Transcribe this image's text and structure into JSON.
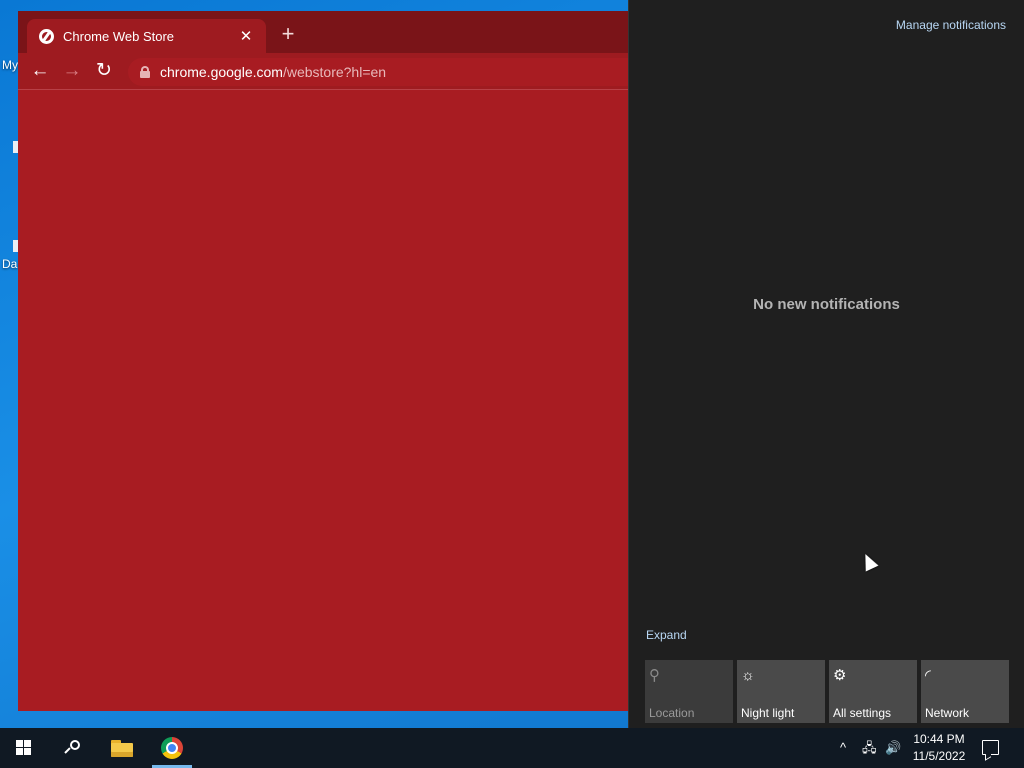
{
  "desktop": {
    "icon_labels": [
      "My",
      "Da"
    ]
  },
  "browser": {
    "tab": {
      "title": "Chrome Web Store",
      "close_glyph": "✕"
    },
    "new_tab_glyph": "+",
    "nav": {
      "back_glyph": "←",
      "forward_glyph": "→",
      "reload_glyph": "↻"
    },
    "url": {
      "host": "chrome.google.com",
      "path": "/webstore?hl=en"
    },
    "content_color": "#a81c22"
  },
  "action_center": {
    "manage_label": "Manage notifications",
    "empty_message": "No new notifications",
    "expand_label": "Expand",
    "quick_actions": [
      {
        "label": "Location",
        "icon": "location-icon",
        "glyph": "⚲",
        "enabled": false
      },
      {
        "label": "Night light",
        "icon": "night-light-icon",
        "glyph": "☼",
        "enabled": true
      },
      {
        "label": "All settings",
        "icon": "gear-icon",
        "glyph": "⚙",
        "enabled": true
      },
      {
        "label": "Network",
        "icon": "network-icon",
        "glyph": "◜",
        "enabled": true
      }
    ]
  },
  "taskbar": {
    "tray": {
      "chevron_glyph": "^",
      "network_glyph": "🖧",
      "volume_glyph": "🔊"
    },
    "clock": {
      "time": "10:44 PM",
      "date": "11/5/2022"
    }
  }
}
